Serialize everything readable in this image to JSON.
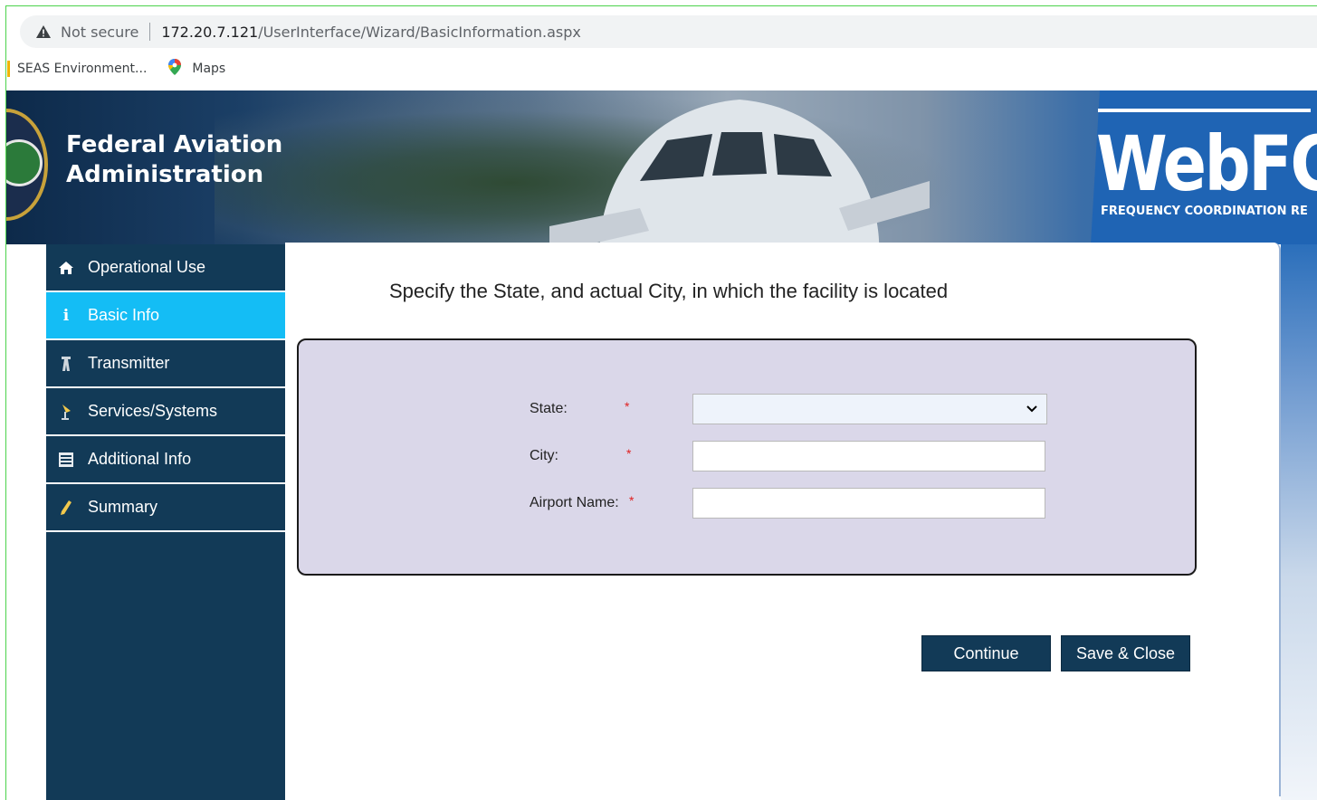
{
  "browser": {
    "security_label": "Not secure",
    "url_host": "172.20.7.121",
    "url_path": "/UserInterface/Wizard/BasicInformation.aspx",
    "bookmarks": [
      {
        "label": "SEAS Environment..."
      },
      {
        "label": "Maps"
      }
    ]
  },
  "banner": {
    "agency_line1": "Federal Aviation",
    "agency_line2": "Administration",
    "app_name": "WebFC",
    "app_tagline": "FREQUENCY COORDINATION RE"
  },
  "sidebar": {
    "items": [
      {
        "label": "Operational Use",
        "icon": "home-icon"
      },
      {
        "label": "Basic Info",
        "icon": "info-icon",
        "active": true
      },
      {
        "label": "Transmitter",
        "icon": "transmitter-tower-icon"
      },
      {
        "label": "Services/Systems",
        "icon": "antenna-icon"
      },
      {
        "label": "Additional Info",
        "icon": "list-icon"
      },
      {
        "label": "Summary",
        "icon": "pencil-icon"
      }
    ]
  },
  "main": {
    "instruction": "Specify the State, and actual City, in which the facility is located",
    "form": {
      "state_label": "State:",
      "state_value": "",
      "city_label": "City:",
      "city_value": "",
      "airport_label": "Airport Name:",
      "airport_value": "",
      "required_marker": "*"
    },
    "buttons": {
      "continue": "Continue",
      "save_close": "Save & Close"
    }
  },
  "colors": {
    "sidebar_bg": "#123a57",
    "sidebar_active": "#14bdf5",
    "form_panel_bg": "#dad7e9",
    "required": "#e02020",
    "button_bg": "#123a57"
  }
}
